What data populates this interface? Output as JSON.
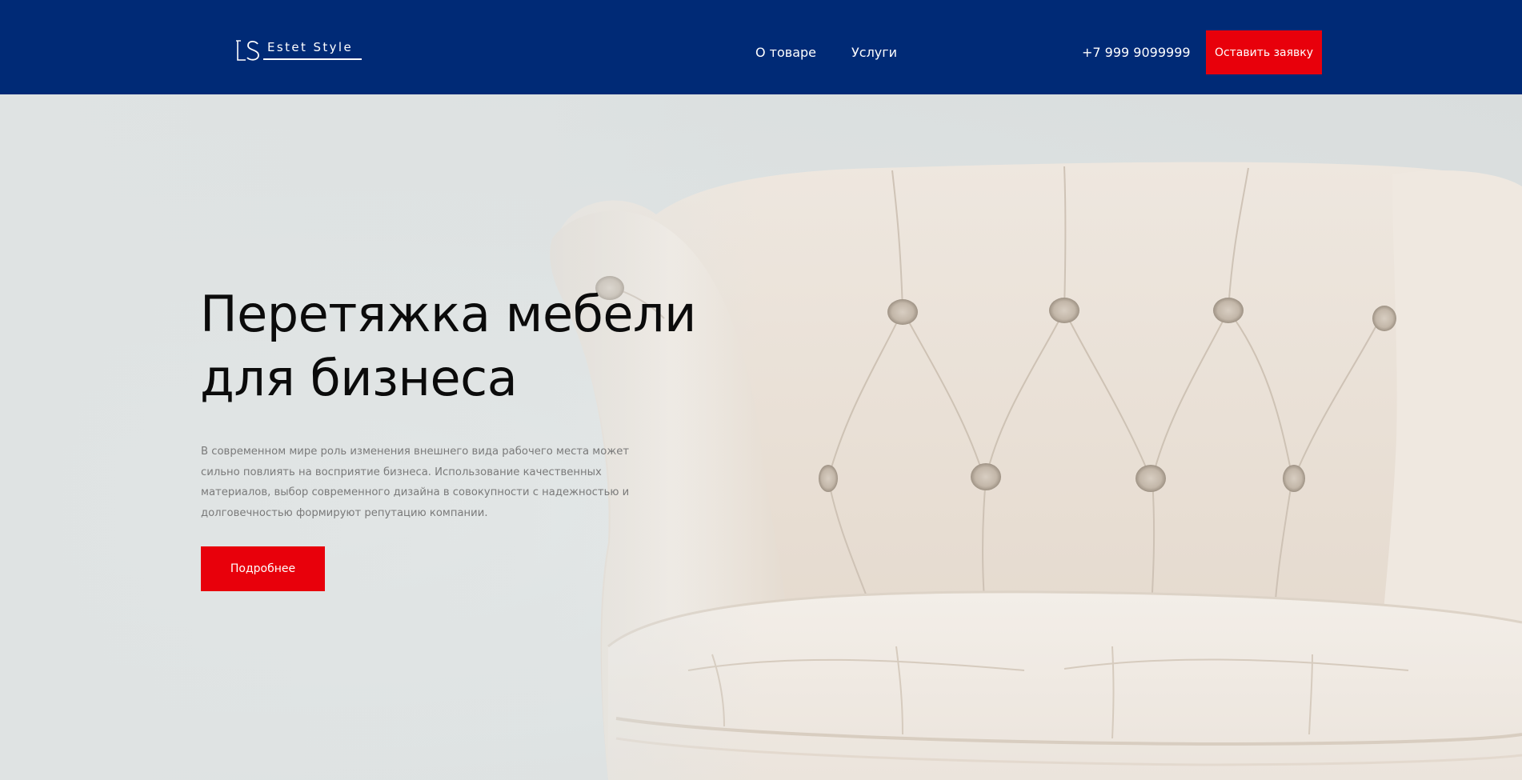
{
  "header": {
    "logo": {
      "monogram": "ES",
      "brand": "Estet Style"
    },
    "nav": [
      {
        "label": "О товаре"
      },
      {
        "label": "Услуги"
      }
    ],
    "phone": "+7 999 9099999",
    "cta_label": "Оставить заявку"
  },
  "hero": {
    "title_lines": [
      "Перетяжка мебели",
      "для бизнеса"
    ],
    "text_lines": [
      "В современном мире роль изменения внешнего вида рабочего места может",
      "сильно повлиять на восприятие бизнеса. Использование качественных",
      "материалов, выбор современного дизайна в совокупности с надежностью и",
      "долговечностью формируют репутацию компании."
    ],
    "cta_label": "Подробнее"
  },
  "colors": {
    "header_bg": "#002a76",
    "accent": "#e8000b",
    "hero_bg": "#dde1e1",
    "title": "#0b0b0b",
    "body_text": "#7a7a7a"
  },
  "icons": {
    "logo": "es-monogram-icon"
  }
}
